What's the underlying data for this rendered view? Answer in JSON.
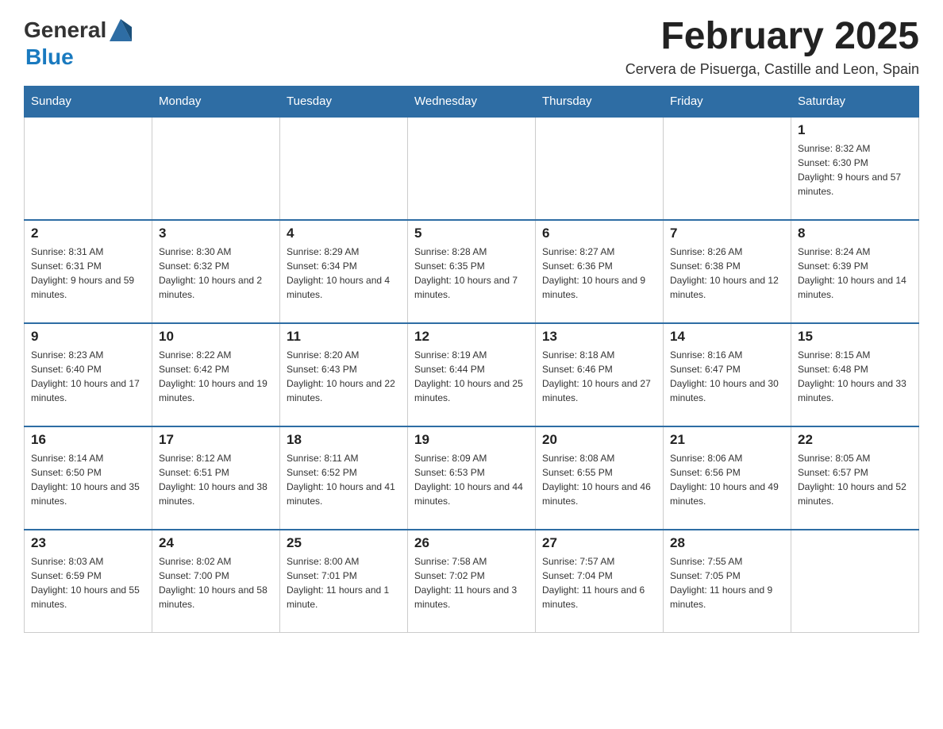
{
  "logo": {
    "general": "General",
    "blue": "Blue"
  },
  "header": {
    "title": "February 2025",
    "subtitle": "Cervera de Pisuerga, Castille and Leon, Spain"
  },
  "days_of_week": [
    "Sunday",
    "Monday",
    "Tuesday",
    "Wednesday",
    "Thursday",
    "Friday",
    "Saturday"
  ],
  "weeks": [
    {
      "days": [
        {
          "num": "",
          "info": ""
        },
        {
          "num": "",
          "info": ""
        },
        {
          "num": "",
          "info": ""
        },
        {
          "num": "",
          "info": ""
        },
        {
          "num": "",
          "info": ""
        },
        {
          "num": "",
          "info": ""
        },
        {
          "num": "1",
          "info": "Sunrise: 8:32 AM\nSunset: 6:30 PM\nDaylight: 9 hours and 57 minutes."
        }
      ]
    },
    {
      "days": [
        {
          "num": "2",
          "info": "Sunrise: 8:31 AM\nSunset: 6:31 PM\nDaylight: 9 hours and 59 minutes."
        },
        {
          "num": "3",
          "info": "Sunrise: 8:30 AM\nSunset: 6:32 PM\nDaylight: 10 hours and 2 minutes."
        },
        {
          "num": "4",
          "info": "Sunrise: 8:29 AM\nSunset: 6:34 PM\nDaylight: 10 hours and 4 minutes."
        },
        {
          "num": "5",
          "info": "Sunrise: 8:28 AM\nSunset: 6:35 PM\nDaylight: 10 hours and 7 minutes."
        },
        {
          "num": "6",
          "info": "Sunrise: 8:27 AM\nSunset: 6:36 PM\nDaylight: 10 hours and 9 minutes."
        },
        {
          "num": "7",
          "info": "Sunrise: 8:26 AM\nSunset: 6:38 PM\nDaylight: 10 hours and 12 minutes."
        },
        {
          "num": "8",
          "info": "Sunrise: 8:24 AM\nSunset: 6:39 PM\nDaylight: 10 hours and 14 minutes."
        }
      ]
    },
    {
      "days": [
        {
          "num": "9",
          "info": "Sunrise: 8:23 AM\nSunset: 6:40 PM\nDaylight: 10 hours and 17 minutes."
        },
        {
          "num": "10",
          "info": "Sunrise: 8:22 AM\nSunset: 6:42 PM\nDaylight: 10 hours and 19 minutes."
        },
        {
          "num": "11",
          "info": "Sunrise: 8:20 AM\nSunset: 6:43 PM\nDaylight: 10 hours and 22 minutes."
        },
        {
          "num": "12",
          "info": "Sunrise: 8:19 AM\nSunset: 6:44 PM\nDaylight: 10 hours and 25 minutes."
        },
        {
          "num": "13",
          "info": "Sunrise: 8:18 AM\nSunset: 6:46 PM\nDaylight: 10 hours and 27 minutes."
        },
        {
          "num": "14",
          "info": "Sunrise: 8:16 AM\nSunset: 6:47 PM\nDaylight: 10 hours and 30 minutes."
        },
        {
          "num": "15",
          "info": "Sunrise: 8:15 AM\nSunset: 6:48 PM\nDaylight: 10 hours and 33 minutes."
        }
      ]
    },
    {
      "days": [
        {
          "num": "16",
          "info": "Sunrise: 8:14 AM\nSunset: 6:50 PM\nDaylight: 10 hours and 35 minutes."
        },
        {
          "num": "17",
          "info": "Sunrise: 8:12 AM\nSunset: 6:51 PM\nDaylight: 10 hours and 38 minutes."
        },
        {
          "num": "18",
          "info": "Sunrise: 8:11 AM\nSunset: 6:52 PM\nDaylight: 10 hours and 41 minutes."
        },
        {
          "num": "19",
          "info": "Sunrise: 8:09 AM\nSunset: 6:53 PM\nDaylight: 10 hours and 44 minutes."
        },
        {
          "num": "20",
          "info": "Sunrise: 8:08 AM\nSunset: 6:55 PM\nDaylight: 10 hours and 46 minutes."
        },
        {
          "num": "21",
          "info": "Sunrise: 8:06 AM\nSunset: 6:56 PM\nDaylight: 10 hours and 49 minutes."
        },
        {
          "num": "22",
          "info": "Sunrise: 8:05 AM\nSunset: 6:57 PM\nDaylight: 10 hours and 52 minutes."
        }
      ]
    },
    {
      "days": [
        {
          "num": "23",
          "info": "Sunrise: 8:03 AM\nSunset: 6:59 PM\nDaylight: 10 hours and 55 minutes."
        },
        {
          "num": "24",
          "info": "Sunrise: 8:02 AM\nSunset: 7:00 PM\nDaylight: 10 hours and 58 minutes."
        },
        {
          "num": "25",
          "info": "Sunrise: 8:00 AM\nSunset: 7:01 PM\nDaylight: 11 hours and 1 minute."
        },
        {
          "num": "26",
          "info": "Sunrise: 7:58 AM\nSunset: 7:02 PM\nDaylight: 11 hours and 3 minutes."
        },
        {
          "num": "27",
          "info": "Sunrise: 7:57 AM\nSunset: 7:04 PM\nDaylight: 11 hours and 6 minutes."
        },
        {
          "num": "28",
          "info": "Sunrise: 7:55 AM\nSunset: 7:05 PM\nDaylight: 11 hours and 9 minutes."
        },
        {
          "num": "",
          "info": ""
        }
      ]
    }
  ]
}
